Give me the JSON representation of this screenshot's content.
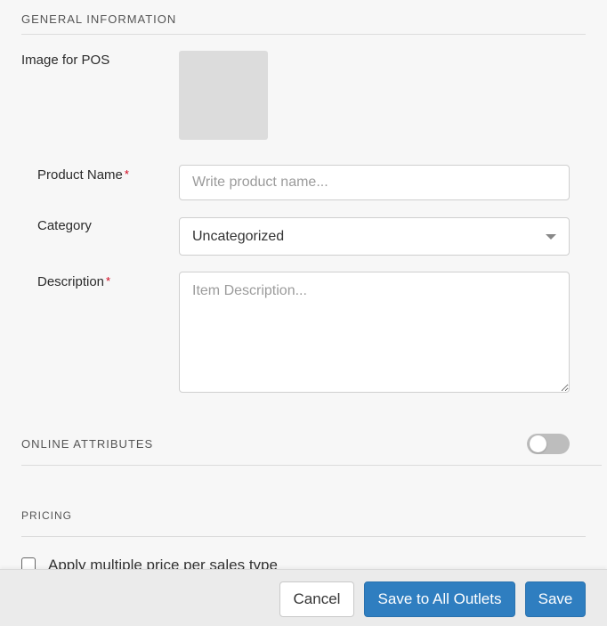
{
  "general": {
    "title": "GENERAL INFORMATION",
    "image_label": "Image for POS",
    "product_name_label": "Product Name",
    "product_name_placeholder": "Write product name...",
    "category_label": "Category",
    "category_value": "Uncategorized",
    "description_label": "Description",
    "description_placeholder": "Item Description...",
    "required_mark": "*"
  },
  "online": {
    "title": "ONLINE ATTRIBUTES",
    "toggle_on": false
  },
  "pricing": {
    "title": "PRICING",
    "multi_price_label": "Apply multiple price per sales type",
    "multi_price_checked": false
  },
  "footer": {
    "cancel_label": "Cancel",
    "save_all_label": "Save to All Outlets",
    "save_label": "Save"
  },
  "colors": {
    "primary": "#2f7ec0",
    "required": "#d0021b",
    "background": "#f7f7f7"
  },
  "icons": {
    "category_caret": "chevron-down-icon"
  }
}
